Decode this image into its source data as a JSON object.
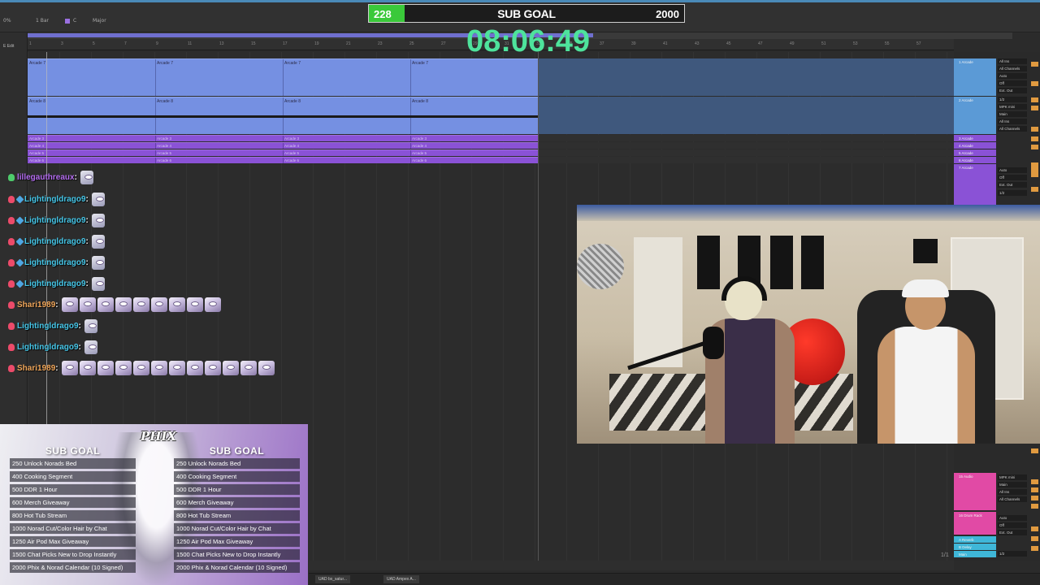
{
  "daw": {
    "toolbar": {
      "cpu": "0%",
      "quantize": "1 Bar",
      "key": "C",
      "scale": "Major",
      "mode": "E Edit"
    },
    "ruler_numbers": [
      "1",
      "3",
      "5",
      "7",
      "9",
      "11",
      "13",
      "15",
      "17",
      "19",
      "21",
      "23",
      "25",
      "27",
      "29",
      "31",
      "33",
      "35",
      "37",
      "39",
      "41",
      "43",
      "45",
      "47",
      "49",
      "51",
      "53",
      "55",
      "57"
    ],
    "clip_rows": [
      {
        "label": "Arcade 7",
        "color": "blue"
      },
      {
        "label": "Arcade 8",
        "color": "blue"
      },
      {
        "label": "Arcade 3",
        "color": "purple"
      },
      {
        "label": "Arcade 4",
        "color": "purple"
      },
      {
        "label": "Arcade 5",
        "color": "purple"
      },
      {
        "label": "Arcade 6",
        "color": "purple"
      }
    ],
    "track_headers": [
      {
        "label": "1 Arcade",
        "color": "#5b9ad6"
      },
      {
        "label": "2 Arcade",
        "color": "#5b9ad6"
      },
      {
        "label": "3 Arcade",
        "color": "#8a52d6"
      },
      {
        "label": "4 Arcade",
        "color": "#8a52d6"
      },
      {
        "label": "5 Arcade",
        "color": "#8a52d6"
      },
      {
        "label": "6 Arcade",
        "color": "#8a52d6"
      },
      {
        "label": "7 Arcade",
        "color": "#8a52d6"
      },
      {
        "label": "15 Audio",
        "color": "#e14aa5"
      },
      {
        "label": "16 Drum Rack",
        "color": "#e14aa5"
      },
      {
        "label": "A Reverb",
        "color": "#3fb7d8"
      },
      {
        "label": "B Delay",
        "color": "#3fb7d8"
      },
      {
        "label": "Main",
        "color": "#3fb7d8"
      }
    ],
    "io_labels": [
      "All Ins",
      "All Channels",
      "Auto",
      "Off",
      "Ext. Out",
      "1/2",
      "MPK mini",
      "Main"
    ],
    "page_indicator": "1/1",
    "bottom_devices": [
      "UAD bx_satur...",
      "UAD Ampex A..."
    ]
  },
  "sub_goal": {
    "title": "SUB GOAL",
    "current": "228",
    "target": "2000",
    "progress": 0.114,
    "fill_color": "#3ac93a"
  },
  "timer": {
    "value": "08:06:49",
    "color": "#4ee39c"
  },
  "chat": [
    {
      "user": "lillegauthreaux",
      "color": "#b46cf0",
      "badge": "green",
      "extra_badge": false,
      "emotes": 1,
      "emote_style": "small"
    },
    {
      "user": "Lightingldrago9",
      "color": "#45c6e8",
      "badge": "red",
      "extra_badge": true,
      "emotes": 1,
      "emote_style": "small"
    },
    {
      "user": "Lightingldrago9",
      "color": "#45c6e8",
      "badge": "red",
      "extra_badge": true,
      "emotes": 1,
      "emote_style": "small"
    },
    {
      "user": "Lightingldrago9",
      "color": "#45c6e8",
      "badge": "red",
      "extra_badge": true,
      "emotes": 1,
      "emote_style": "small"
    },
    {
      "user": "Lightingldrago9",
      "color": "#45c6e8",
      "badge": "red",
      "extra_badge": true,
      "emotes": 1,
      "emote_style": "small"
    },
    {
      "user": "Lightingldrago9",
      "color": "#45c6e8",
      "badge": "red",
      "extra_badge": true,
      "emotes": 1,
      "emote_style": "small"
    },
    {
      "user": "Shari1989",
      "color": "#f0a65a",
      "badge": "red",
      "extra_badge": false,
      "emotes": 9,
      "emote_style": "large"
    },
    {
      "user": "Lightingldrago9",
      "color": "#45c6e8",
      "badge": "red",
      "extra_badge": false,
      "emotes": 1,
      "emote_style": "small"
    },
    {
      "user": "Lightingldrago9",
      "color": "#45c6e8",
      "badge": "red",
      "extra_badge": false,
      "emotes": 1,
      "emote_style": "small"
    },
    {
      "user": "Shari1989",
      "color": "#f0a65a",
      "badge": "red",
      "extra_badge": false,
      "emotes": 12,
      "emote_style": "large"
    }
  ],
  "goal_panel": {
    "logo": "PHIX",
    "heading": "SUB GOAL",
    "items": [
      "250 Unlock Norads Bed",
      "400 Cooking Segment",
      "500 DDR 1 Hour",
      "600 Merch Giveaway",
      "800 Hot Tub Stream",
      "1000 Norad Cut/Color Hair by Chat",
      "1250 Air Pod Max Giveaway",
      "1500 Chat Picks New to Drop Instantly",
      "2000 Phix & Norad Calendar (10 Signed)"
    ]
  }
}
